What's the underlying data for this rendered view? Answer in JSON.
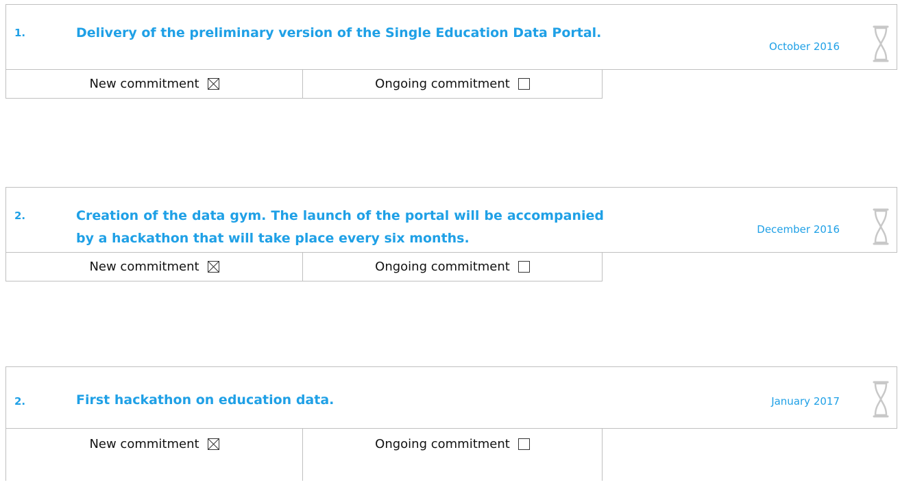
{
  "commitments": [
    {
      "number": "1.",
      "title": "Delivery of the preliminary version of the Single Education Data Portal.",
      "date": "October 2016",
      "new_label": "New commitment",
      "new_checked": true,
      "ongoing_label": "Ongoing commitment",
      "ongoing_checked": false,
      "icon": "hourglass-icon"
    },
    {
      "number": "2.",
      "title": "Creation of the data gym. The launch of the portal will be accompanied by a hackathon that will take place every six months.",
      "date": "December 2016",
      "new_label": "New commitment",
      "new_checked": true,
      "ongoing_label": "Ongoing commitment",
      "ongoing_checked": false,
      "icon": "hourglass-icon"
    },
    {
      "number": "2.",
      "title": "First hackathon on education data.",
      "date": "January 2017",
      "new_label": "New commitment",
      "new_checked": true,
      "ongoing_label": "Ongoing commitment",
      "ongoing_checked": false,
      "icon": "hourglass-icon"
    }
  ],
  "colors": {
    "accent": "#1fa0e6",
    "border": "#bfbfbf"
  }
}
